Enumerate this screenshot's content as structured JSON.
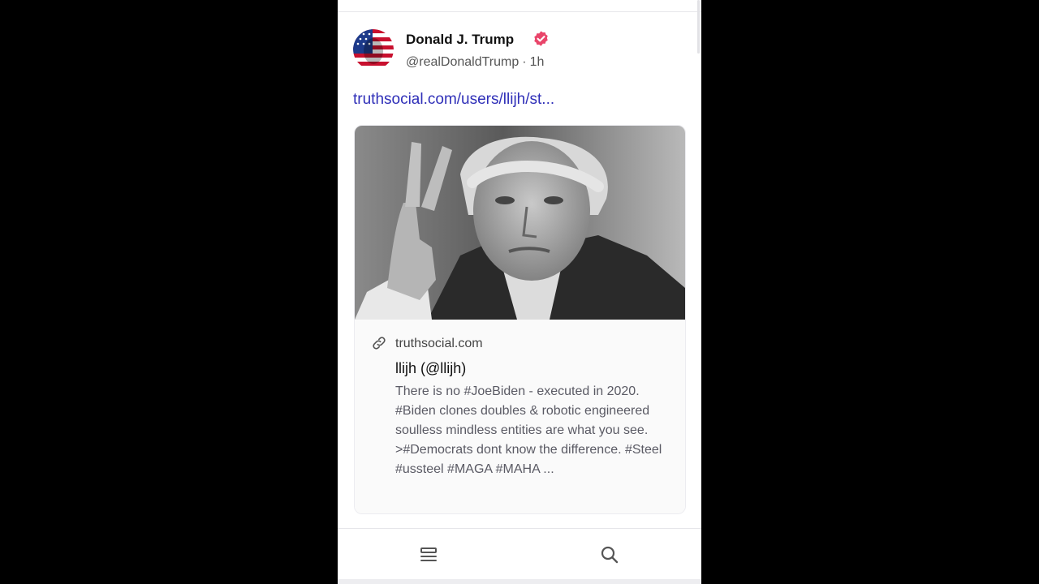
{
  "post": {
    "author_name": "Donald J. Trump",
    "handle": "@realDonaldTrump",
    "separator": "·",
    "time_ago": "1h",
    "link_text": "truthsocial.com/users/llijh/st..."
  },
  "card": {
    "domain": "truthsocial.com",
    "title": "llijh (@llijh)",
    "description": "There is no #JoeBiden - executed in 2020. #Biden clones doubles & robotic engineered soulless mindless entities are what you see. >#Democrats dont know the difference. #Steel #ussteel #MAGA #MAHA ..."
  },
  "icons": {
    "verified": "verified-badge-icon",
    "link": "link-icon",
    "feed": "feed-icon",
    "search": "search-icon"
  },
  "colors": {
    "link": "#2f2fb8",
    "verified": "#e9456a",
    "page_bg": "#000000"
  }
}
